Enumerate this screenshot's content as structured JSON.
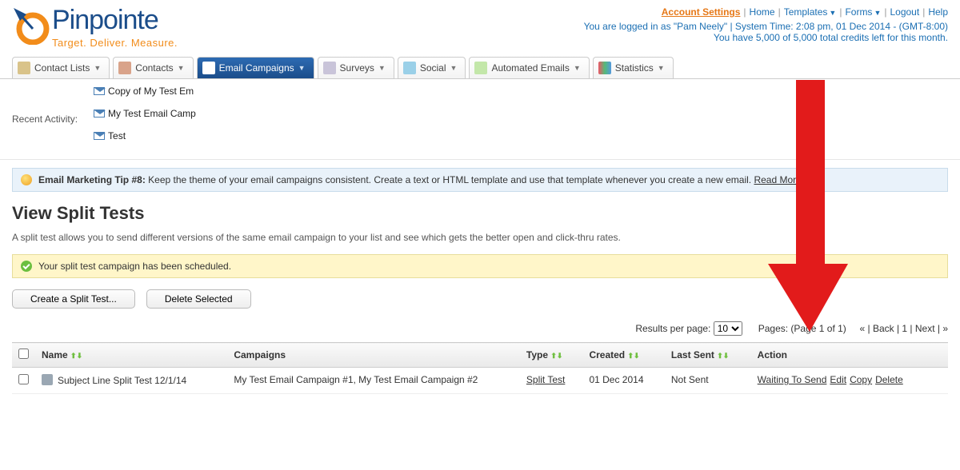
{
  "brand": {
    "name": "Pinpointe",
    "tagline": "Target. Deliver. Measure."
  },
  "topnav": {
    "items": [
      {
        "label": "Account Settings",
        "active": true,
        "dropdown": false
      },
      {
        "label": "Home",
        "dropdown": false
      },
      {
        "label": "Templates",
        "dropdown": true
      },
      {
        "label": "Forms",
        "dropdown": true
      },
      {
        "label": "Logout",
        "dropdown": false
      },
      {
        "label": "Help",
        "dropdown": false
      }
    ],
    "status1": "You are logged in as \"Pam Neely\" | System Time: 2:08 pm, 01 Dec 2014 - (GMT-8:00)",
    "status2": "You have 5,000 of 5,000 total credits left for this month."
  },
  "tabs": [
    {
      "label": "Contact Lists",
      "icon": "ic-contactlists"
    },
    {
      "label": "Contacts",
      "icon": "ic-contacts"
    },
    {
      "label": "Email Campaigns",
      "icon": "ic-email",
      "active": true
    },
    {
      "label": "Surveys",
      "icon": "ic-surveys"
    },
    {
      "label": "Social",
      "icon": "ic-social"
    },
    {
      "label": "Automated Emails",
      "icon": "ic-auto"
    },
    {
      "label": "Statistics",
      "icon": "ic-stats"
    }
  ],
  "recent": {
    "label": "Recent Activity:",
    "items": [
      "Copy of My Test Em",
      "My Test Email Camp",
      "Test"
    ]
  },
  "tip": {
    "title": "Email Marketing Tip #8:",
    "body": "Keep the theme of your email campaigns consistent. Create a text or HTML template and use that template whenever you create a new email.",
    "more": "Read More..."
  },
  "page": {
    "title": "View Split Tests",
    "desc": "A split test allows you to send different versions of the same email campaign to your list and see which gets the better open and click-thru rates."
  },
  "success": "Your split test campaign has been scheduled.",
  "buttons": {
    "create": "Create a Split Test...",
    "delete": "Delete Selected"
  },
  "pager": {
    "rpp_label": "Results per page:",
    "rpp_value": "10",
    "pages_label": "Pages: (Page 1 of 1)",
    "nav": "« | Back | 1 | Next | »"
  },
  "table": {
    "headers": [
      "",
      "Name",
      "Campaigns",
      "Type",
      "Created",
      "Last Sent",
      "Action"
    ],
    "rows": [
      {
        "name": "Subject Line Split Test 12/1/14",
        "campaigns": "My Test Email Campaign #1, My Test Email Campaign #2",
        "type": "Split Test",
        "created": "01 Dec 2014",
        "last_sent": "Not Sent",
        "actions": [
          "Waiting To Send",
          "Edit",
          "Copy",
          "Delete"
        ]
      }
    ]
  }
}
